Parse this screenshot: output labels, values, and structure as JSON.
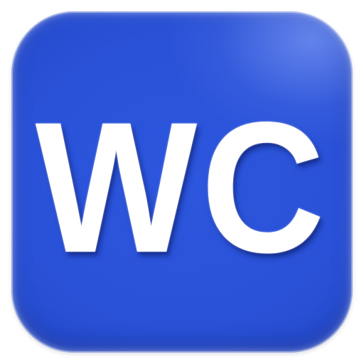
{
  "sign": {
    "label": "WC",
    "icon": "restroom-sign-icon",
    "background_color": "#2a52d8",
    "text_color": "#ffffff"
  }
}
